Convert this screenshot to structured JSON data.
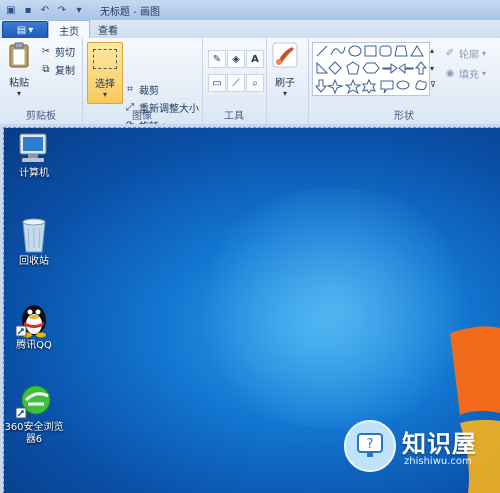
{
  "window": {
    "title": "无标题 - 画图"
  },
  "tabs": {
    "file": "",
    "home": "主页",
    "view": "查看"
  },
  "ribbon": {
    "clipboard": {
      "paste": "粘贴",
      "cut": "剪切",
      "copy": "复制",
      "label": "剪贴板"
    },
    "image": {
      "select": "选择",
      "crop": "裁剪",
      "resize": "重新调整大小",
      "rotate": "旋转",
      "label": "图像"
    },
    "tools": {
      "label": "工具",
      "text_tool": "A"
    },
    "brushes": {
      "label": "刷子"
    },
    "shapes": {
      "label": "形状",
      "outline": "轮廓",
      "fill": "填充"
    }
  },
  "desktop": {
    "icons": [
      {
        "label": "计算机"
      },
      {
        "label": "回收站"
      },
      {
        "label": "腾讯QQ"
      },
      {
        "label": "360安全浏览器6"
      }
    ]
  },
  "watermark": {
    "title": "知识屋",
    "url": "zhishiwu.com"
  },
  "colors": {
    "accent": "#1f5bb7",
    "select_highlight": "#f9c95a",
    "desktop": "#1276d1"
  }
}
